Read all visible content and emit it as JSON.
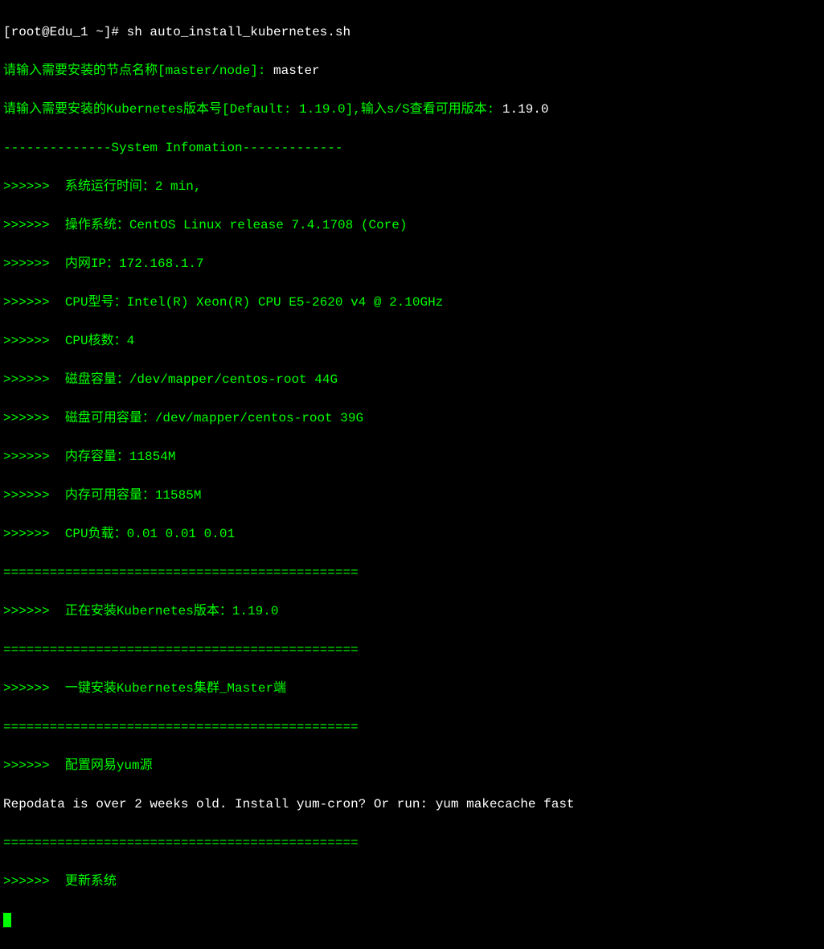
{
  "prompt": {
    "user_host": "[root@Edu_1 ~]# ",
    "command": "sh auto_install_kubernetes.sh"
  },
  "input1": {
    "label": "请输入需要安装的节点名称[master/node]: ",
    "value": "master"
  },
  "input2": {
    "label": "请输入需要安装的Kubernetes版本号[Default: 1.19.0],输入s/S查看可用版本: ",
    "value": "1.19.0"
  },
  "sys_header": "--------------System Infomation-------------",
  "sys_info": {
    "uptime": ">>>>>>  系统运行时间：2 min,",
    "os": ">>>>>>  操作系统：CentOS Linux release 7.4.1708 (Core)",
    "lan_ip": ">>>>>>  内网IP：172.168.1.7",
    "cpu_model": ">>>>>>  CPU型号：Intel(R) Xeon(R) CPU E5-2620 v4 @ 2.10GHz",
    "cpu_cores": ">>>>>>  CPU核数：4",
    "disk_cap": ">>>>>>  磁盘容量：/dev/mapper/centos-root 44G",
    "disk_avail": ">>>>>>  磁盘可用容量：/dev/mapper/centos-root 39G",
    "mem_cap": ">>>>>>  内存容量：11854M",
    "mem_avail": ">>>>>>  内存可用容量：11585M",
    "cpu_load": ">>>>>>  CPU负载：0.01 0.01 0.01"
  },
  "divider": "==============================================",
  "status": {
    "installing": ">>>>>>  正在安装Kubernetes版本：1.19.0",
    "one_click": ">>>>>>  一键安装Kubernetes集群_Master端",
    "yum_source": ">>>>>>  配置网易yum源",
    "repodata": "Repodata is over 2 weeks old. Install yum-cron? Or run: yum makecache fast",
    "update": ">>>>>>  更新系统"
  }
}
